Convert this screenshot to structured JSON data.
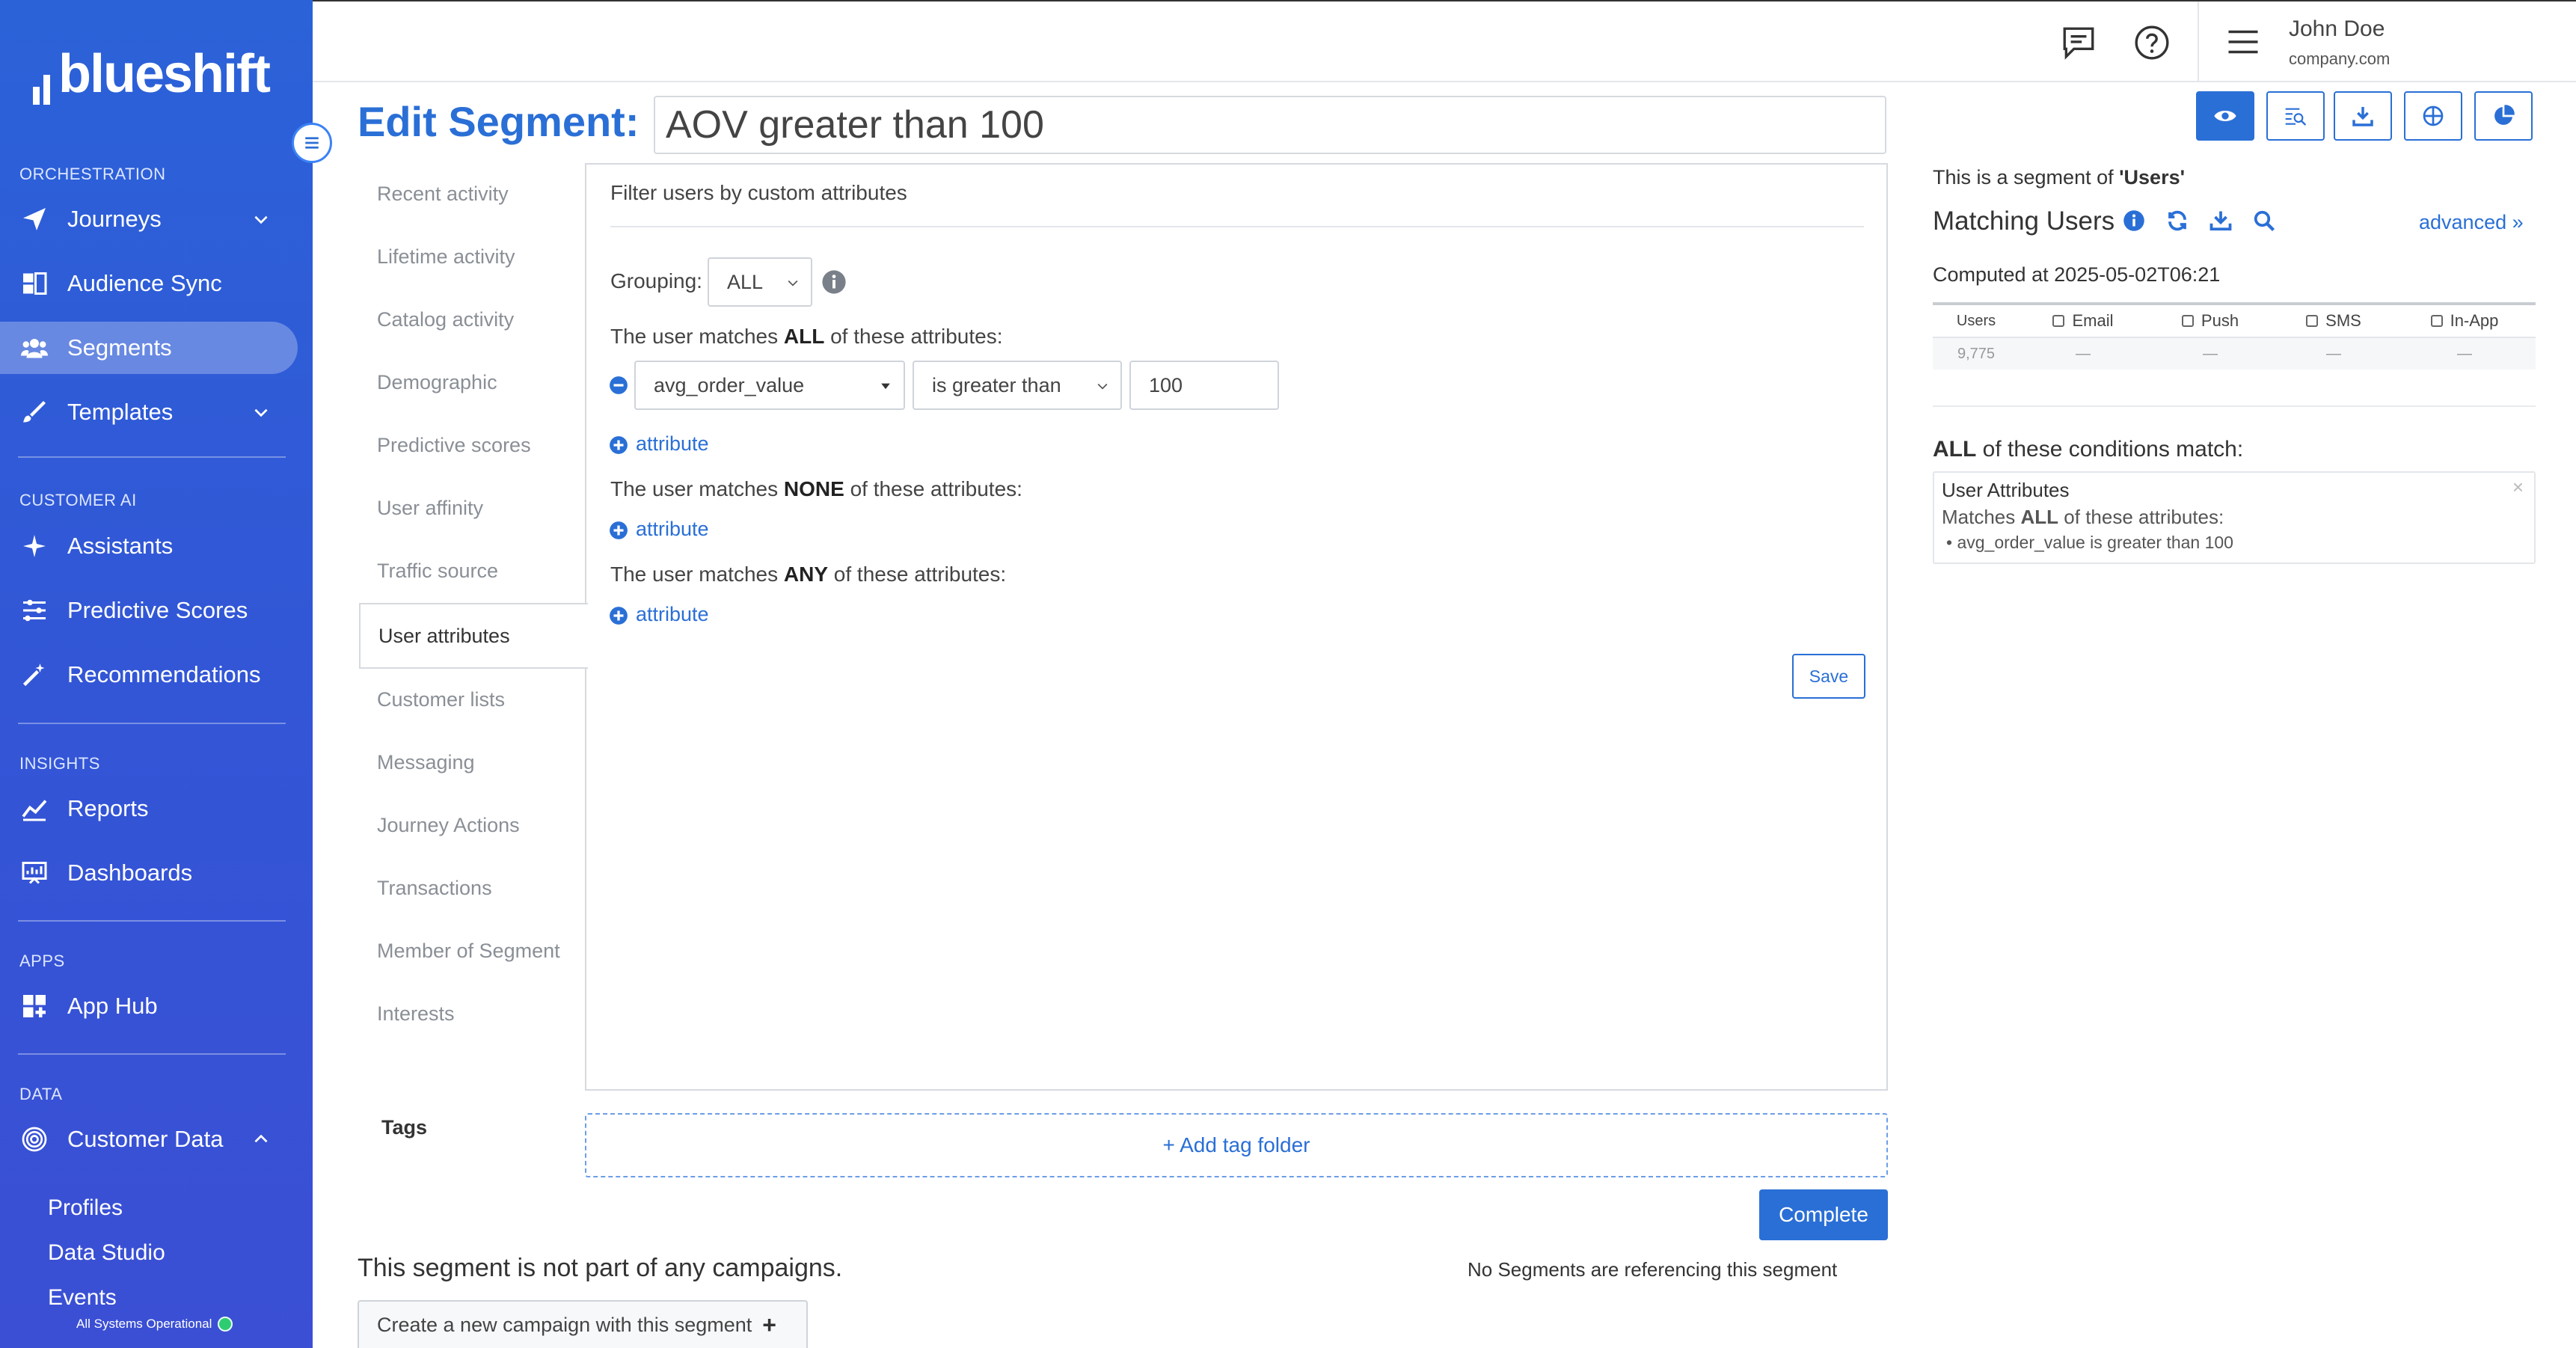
{
  "sidebar": {
    "logo": "blueshift",
    "sections": {
      "orchestration": "ORCHESTRATION",
      "customer_ai": "CUSTOMER AI",
      "insights": "INSIGHTS",
      "apps": "APPS",
      "data": "DATA"
    },
    "items": {
      "journeys": "Journeys",
      "audience_sync": "Audience Sync",
      "segments": "Segments",
      "templates": "Templates",
      "assistants": "Assistants",
      "predictive_scores": "Predictive Scores",
      "recommendations": "Recommendations",
      "reports": "Reports",
      "dashboards": "Dashboards",
      "app_hub": "App Hub",
      "customer_data": "Customer Data"
    },
    "sub_items": [
      "Profiles",
      "Data Studio",
      "Events"
    ],
    "status": "All Systems Operational",
    "accent_color": "#2b62d8"
  },
  "header": {
    "user_name": "John Doe",
    "user_company": "company.com",
    "icons": [
      "chat-icon",
      "help-icon",
      "hamburger-icon"
    ]
  },
  "editor": {
    "title_label": "Edit Segment:",
    "segment_name": "AOV greater than 100"
  },
  "tabs": [
    "Recent activity",
    "Lifetime activity",
    "Catalog activity",
    "Demographic",
    "Predictive scores",
    "User affinity",
    "Traffic source",
    "User attributes",
    "Customer lists",
    "Messaging",
    "Journey Actions",
    "Transactions",
    "Member of Segment",
    "Interests"
  ],
  "active_tab": "User attributes",
  "filter": {
    "title": "Filter users by custom attributes",
    "grouping_label": "Grouping:",
    "grouping_value": "ALL",
    "all_prefix": "The user matches",
    "all_keyword": "ALL",
    "all_suffix": "of these attributes:",
    "none_prefix": "The user matches",
    "none_keyword": "NONE",
    "none_suffix": "of these attributes:",
    "any_prefix": "The user matches",
    "any_keyword": "ANY",
    "any_suffix": "of these attributes:",
    "attribute_field": "avg_order_value",
    "operator": "is greater than",
    "value": "100",
    "add_attribute": "attribute",
    "save": "Save"
  },
  "tags": {
    "label": "Tags",
    "add_folder": "+ Add tag folder"
  },
  "actions": {
    "complete": "Complete",
    "not_part": "This segment is not part of any campaigns.",
    "no_referencing": "No Segments are referencing this segment",
    "create_campaign": "Create a new campaign with this segment",
    "create_plus": "+"
  },
  "right_panel": {
    "segment_of_prefix": "This is a segment of",
    "segment_of_value": "'Users'",
    "matching_users": "Matching Users",
    "advanced": "advanced »",
    "computed_at": "Computed at 2025-05-02T06:21",
    "columns": [
      "Users",
      "Email",
      "Push",
      "SMS",
      "In-App"
    ],
    "values": [
      "9,775",
      "—",
      "—",
      "—",
      "—"
    ],
    "conditions_keyword": "ALL",
    "conditions_suffix": "of these conditions match:",
    "condition_title": "User Attributes",
    "condition_matches_prefix": "Matches",
    "condition_matches_keyword": "ALL",
    "condition_matches_suffix": "of these attributes:",
    "condition_detail": "• avg_order_value is greater than 100",
    "condition_close": "×"
  }
}
